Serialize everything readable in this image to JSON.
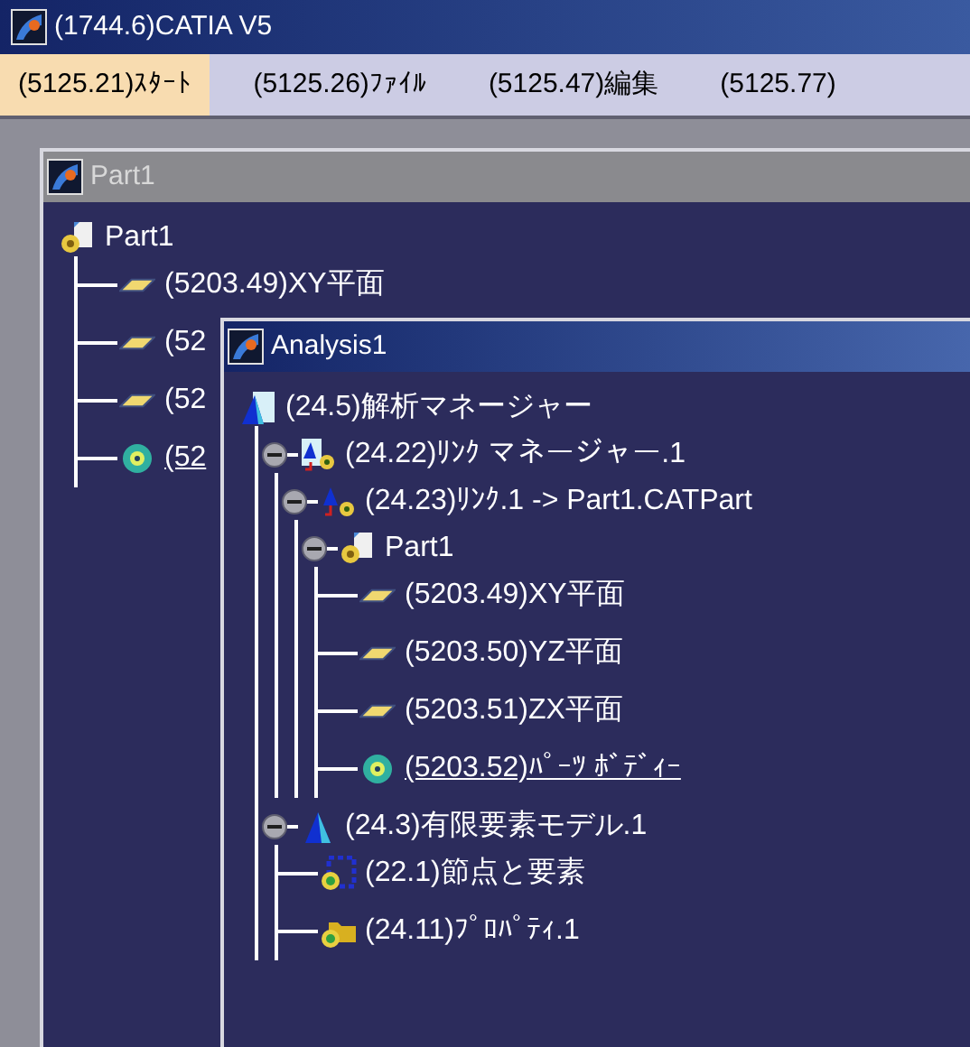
{
  "window": {
    "title": "(1744.6)CATIA V5"
  },
  "menu": [
    {
      "label": "(5125.21)ｽﾀｰﾄ",
      "selected": true
    },
    {
      "label": "(5125.26)ﾌｧｲﾙ",
      "selected": false
    },
    {
      "label": "(5125.47)編集",
      "selected": false
    },
    {
      "label": "(5125.77)",
      "selected": false
    }
  ],
  "part_window": {
    "title": "Part1",
    "active": false,
    "tree": [
      {
        "kind": "part",
        "label": "Part1",
        "children": [
          {
            "kind": "plane",
            "label": "(5203.49)XY平面",
            "in_work": false
          },
          {
            "kind": "plane",
            "label": "(52",
            "in_work": false
          },
          {
            "kind": "plane",
            "label": "(52",
            "in_work": false
          },
          {
            "kind": "body",
            "label": "(52",
            "in_work": true
          }
        ]
      }
    ]
  },
  "analysis_window": {
    "title": "Analysis1",
    "active": true,
    "tree": [
      {
        "kind": "analysis",
        "label": "(24.5)解析マネージャー",
        "children": [
          {
            "kind": "link-manager",
            "label": "(24.22)ﾘﾝｸ マネージャー.1",
            "expanded": true,
            "children": [
              {
                "kind": "link",
                "label": "(24.23)ﾘﾝｸ.1 -> Part1.CATPart",
                "expanded": true,
                "children": [
                  {
                    "kind": "part",
                    "label": "Part1",
                    "expanded": true,
                    "children": [
                      {
                        "kind": "plane",
                        "label": "(5203.49)XY平面",
                        "in_work": false
                      },
                      {
                        "kind": "plane",
                        "label": "(5203.50)YZ平面",
                        "in_work": false
                      },
                      {
                        "kind": "plane",
                        "label": "(5203.51)ZX平面",
                        "in_work": false
                      },
                      {
                        "kind": "body",
                        "label": "(5203.52)ﾊﾟｰﾂ ﾎﾞﾃﾞｨｰ",
                        "in_work": true
                      }
                    ]
                  }
                ]
              }
            ]
          },
          {
            "kind": "fem-model",
            "label": "(24.3)有限要素モデル.1",
            "expanded": true,
            "children": [
              {
                "kind": "nodes",
                "label": "(22.1)節点と要素"
              },
              {
                "kind": "property",
                "label": "(24.11)ﾌﾟﾛﾊﾟﾃｨ.1"
              }
            ]
          }
        ]
      }
    ]
  }
}
